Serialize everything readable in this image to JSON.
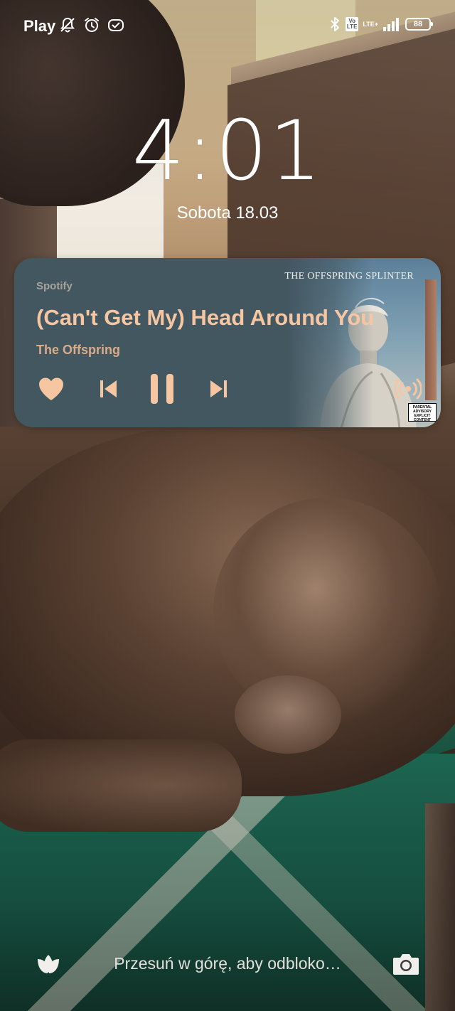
{
  "status_bar": {
    "carrier": "Play",
    "left_icons": [
      "bell-off-icon",
      "alarm-icon",
      "check-badge-icon"
    ],
    "right_icons": [
      "bluetooth-icon",
      "volte-icon",
      "lte-plus-icon",
      "signal-icon",
      "battery-icon"
    ],
    "volte_label": "Vo\nLTE",
    "network_label": "LTE+",
    "battery_level": "88"
  },
  "lock_screen": {
    "time": "4:01",
    "date": "Sobota 18.03"
  },
  "media_player": {
    "app": "Spotify",
    "title": "(Can't Get My) Head Around You",
    "artist": "The Offspring",
    "album_art_text": "THE OFFSPRING SPLINTER",
    "advisory_text": "PARENTAL ADVISORY EXPLICIT CONTENT",
    "state": "playing",
    "colors": {
      "background": "#435761",
      "accent": "#f6c6a2",
      "secondary": "#d8ac8a",
      "label": "#a8a29b"
    },
    "controls": [
      "heart-icon",
      "previous-icon",
      "pause-icon",
      "next-icon",
      "cast-icon"
    ]
  },
  "bottom": {
    "unlock_hint": "Przesuń w górę, aby odbloko…",
    "left_shortcut": "leaf-icon",
    "right_shortcut": "camera-icon"
  }
}
